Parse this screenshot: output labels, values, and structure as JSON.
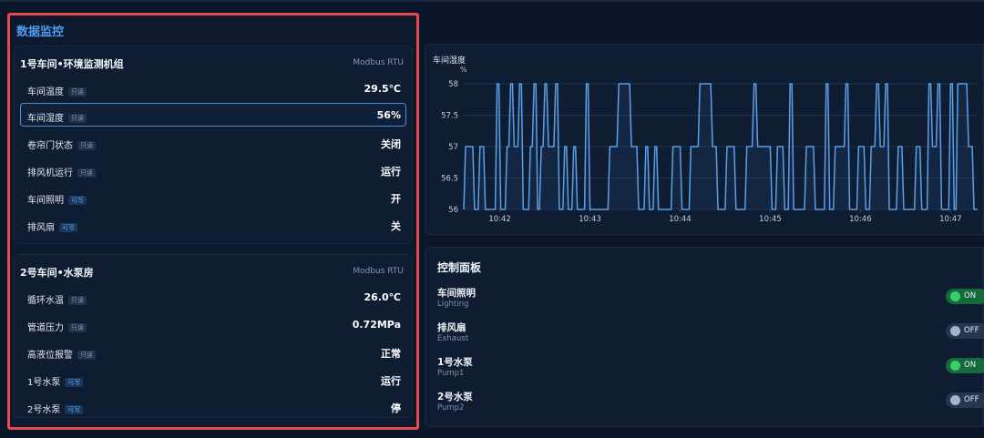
{
  "monitor": {
    "title": "数据监控",
    "groups": [
      {
        "title": "1号车间•环境监测机组",
        "protocol": "Modbus RTU",
        "rows": [
          {
            "label": "车间温度",
            "tag": "只读",
            "value": "29.5℃"
          },
          {
            "label": "车间湿度",
            "tag": "只读",
            "value": "56%"
          },
          {
            "label": "卷帘门状态",
            "tag": "只读",
            "value": "关闭"
          },
          {
            "label": "排风机运行",
            "tag": "只读",
            "value": "运行"
          },
          {
            "label": "车间照明",
            "tag": "可写",
            "value": "开"
          },
          {
            "label": "排风扇",
            "tag": "可写",
            "value": "关"
          }
        ]
      },
      {
        "title": "2号车间•水泵房",
        "protocol": "Modbus RTU",
        "rows": [
          {
            "label": "循环水温",
            "tag": "只读",
            "value": "26.0℃"
          },
          {
            "label": "管道压力",
            "tag": "只读",
            "value": "0.72MPa"
          },
          {
            "label": "高液位报警",
            "tag": "只读",
            "value": "正常"
          },
          {
            "label": "1号水泵",
            "tag": "可写",
            "value": "运行"
          },
          {
            "label": "2号水泵",
            "tag": "可写",
            "value": "停"
          }
        ]
      }
    ]
  },
  "chart_data": {
    "type": "line",
    "title": "车间湿度",
    "ylabel": "%",
    "ylim": [
      56,
      58
    ],
    "yticks": [
      56,
      56.5,
      57,
      57.5,
      58
    ],
    "xticks": [
      "10:42",
      "10:43",
      "10:44",
      "10:45",
      "10:46",
      "10:47"
    ],
    "xlim_minutes": [
      41.6,
      47.3
    ],
    "grid": true,
    "series": [
      {
        "color": "#5b9fe8",
        "points": [
          [
            41.6,
            56
          ],
          [
            41.62,
            57
          ],
          [
            41.7,
            57
          ],
          [
            41.72,
            56
          ],
          [
            41.76,
            56
          ],
          [
            41.78,
            57
          ],
          [
            41.82,
            57
          ],
          [
            41.84,
            56
          ],
          [
            41.95,
            56
          ],
          [
            41.97,
            58
          ],
          [
            41.99,
            58
          ],
          [
            42.01,
            56
          ],
          [
            42.06,
            56
          ],
          [
            42.08,
            57
          ],
          [
            42.1,
            57
          ],
          [
            42.12,
            58
          ],
          [
            42.14,
            58
          ],
          [
            42.16,
            57
          ],
          [
            42.2,
            57
          ],
          [
            42.22,
            58
          ],
          [
            42.24,
            58
          ],
          [
            42.26,
            56
          ],
          [
            42.32,
            56
          ],
          [
            42.34,
            57
          ],
          [
            42.36,
            57
          ],
          [
            42.38,
            58
          ],
          [
            42.4,
            58
          ],
          [
            42.42,
            56
          ],
          [
            42.44,
            56
          ],
          [
            42.46,
            57
          ],
          [
            42.48,
            57
          ],
          [
            42.5,
            58
          ],
          [
            42.52,
            58
          ],
          [
            42.54,
            57
          ],
          [
            42.6,
            57
          ],
          [
            42.62,
            58
          ],
          [
            42.64,
            58
          ],
          [
            42.66,
            56
          ],
          [
            42.7,
            56
          ],
          [
            42.72,
            57
          ],
          [
            42.74,
            57
          ],
          [
            42.76,
            56
          ],
          [
            42.8,
            56
          ],
          [
            42.82,
            57
          ],
          [
            42.84,
            57
          ],
          [
            42.86,
            56
          ],
          [
            42.94,
            56
          ],
          [
            42.96,
            58
          ],
          [
            42.98,
            58
          ],
          [
            43.0,
            56
          ],
          [
            43.2,
            56
          ],
          [
            43.22,
            57
          ],
          [
            43.3,
            57
          ],
          [
            43.32,
            58
          ],
          [
            43.44,
            58
          ],
          [
            43.46,
            57
          ],
          [
            43.52,
            57
          ],
          [
            43.54,
            56
          ],
          [
            43.6,
            56
          ],
          [
            43.62,
            57
          ],
          [
            43.64,
            57
          ],
          [
            43.66,
            56
          ],
          [
            43.7,
            56
          ],
          [
            43.72,
            57
          ],
          [
            43.74,
            57
          ],
          [
            43.76,
            56
          ],
          [
            43.9,
            56
          ],
          [
            43.92,
            57
          ],
          [
            44.0,
            57
          ],
          [
            44.02,
            56
          ],
          [
            44.1,
            56
          ],
          [
            44.12,
            57
          ],
          [
            44.2,
            57
          ],
          [
            44.22,
            58
          ],
          [
            44.34,
            58
          ],
          [
            44.36,
            57
          ],
          [
            44.4,
            57
          ],
          [
            44.42,
            56
          ],
          [
            44.5,
            56
          ],
          [
            44.52,
            57
          ],
          [
            44.6,
            57
          ],
          [
            44.62,
            56
          ],
          [
            44.72,
            56
          ],
          [
            44.74,
            57
          ],
          [
            44.8,
            57
          ],
          [
            44.82,
            58
          ],
          [
            44.84,
            58
          ],
          [
            44.86,
            57
          ],
          [
            45.0,
            57
          ],
          [
            45.02,
            56
          ],
          [
            45.06,
            56
          ],
          [
            45.08,
            57
          ],
          [
            45.14,
            57
          ],
          [
            45.16,
            56
          ],
          [
            45.2,
            56
          ],
          [
            45.22,
            58
          ],
          [
            45.24,
            58
          ],
          [
            45.26,
            56
          ],
          [
            45.38,
            56
          ],
          [
            45.4,
            57
          ],
          [
            45.48,
            57
          ],
          [
            45.5,
            56
          ],
          [
            45.6,
            56
          ],
          [
            45.62,
            58
          ],
          [
            45.64,
            58
          ],
          [
            45.66,
            56
          ],
          [
            45.7,
            56
          ],
          [
            45.72,
            57
          ],
          [
            45.82,
            57
          ],
          [
            45.84,
            58
          ],
          [
            45.86,
            58
          ],
          [
            45.88,
            56
          ],
          [
            45.96,
            56
          ],
          [
            45.98,
            57
          ],
          [
            46.04,
            57
          ],
          [
            46.06,
            56
          ],
          [
            46.1,
            56
          ],
          [
            46.12,
            57
          ],
          [
            46.16,
            57
          ],
          [
            46.18,
            58
          ],
          [
            46.2,
            58
          ],
          [
            46.22,
            57
          ],
          [
            46.26,
            57
          ],
          [
            46.28,
            58
          ],
          [
            46.3,
            58
          ],
          [
            46.32,
            56
          ],
          [
            46.4,
            56
          ],
          [
            46.42,
            57
          ],
          [
            46.46,
            57
          ],
          [
            46.48,
            56
          ],
          [
            46.6,
            56
          ],
          [
            46.62,
            57
          ],
          [
            46.66,
            57
          ],
          [
            46.68,
            56
          ],
          [
            46.74,
            56
          ],
          [
            46.76,
            58
          ],
          [
            46.78,
            58
          ],
          [
            46.8,
            57
          ],
          [
            46.84,
            57
          ],
          [
            46.86,
            58
          ],
          [
            46.88,
            58
          ],
          [
            46.9,
            56
          ],
          [
            46.98,
            56
          ],
          [
            47.0,
            58
          ],
          [
            47.02,
            58
          ],
          [
            47.04,
            56
          ],
          [
            47.06,
            56
          ],
          [
            47.08,
            58
          ],
          [
            47.18,
            58
          ],
          [
            47.2,
            57
          ],
          [
            47.24,
            57
          ],
          [
            47.26,
            56
          ],
          [
            47.3,
            56
          ]
        ]
      }
    ]
  },
  "control": {
    "title": "控制面板",
    "items": [
      {
        "name": "车间照明",
        "sub": "Lighting",
        "state": "ON"
      },
      {
        "name": "排风扇",
        "sub": "Exhaust",
        "state": "OFF"
      },
      {
        "name": "1号水泵",
        "sub": "Pump1",
        "state": "ON"
      },
      {
        "name": "2号水泵",
        "sub": "Pump2",
        "state": "OFF"
      }
    ]
  }
}
